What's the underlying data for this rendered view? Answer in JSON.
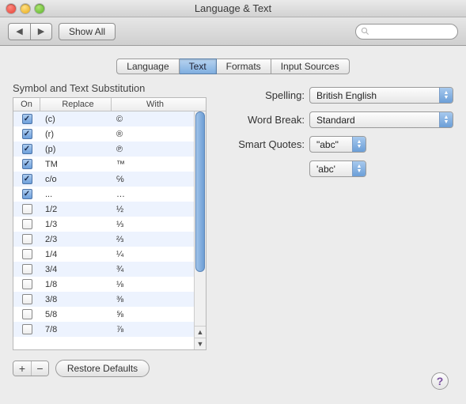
{
  "window": {
    "title": "Language & Text"
  },
  "toolbar": {
    "show_all": "Show All",
    "search_placeholder": ""
  },
  "tabs": [
    {
      "label": "Language",
      "active": false
    },
    {
      "label": "Text",
      "active": true
    },
    {
      "label": "Formats",
      "active": false
    },
    {
      "label": "Input Sources",
      "active": false
    }
  ],
  "section_title": "Symbol and Text Substitution",
  "columns": {
    "on": "On",
    "replace": "Replace",
    "with": "With"
  },
  "rows": [
    {
      "on": true,
      "replace": "(c)",
      "with": "©"
    },
    {
      "on": true,
      "replace": "(r)",
      "with": "®"
    },
    {
      "on": true,
      "replace": "(p)",
      "with": "℗"
    },
    {
      "on": true,
      "replace": "TM",
      "with": "™"
    },
    {
      "on": true,
      "replace": "c/o",
      "with": "℅"
    },
    {
      "on": true,
      "replace": "...",
      "with": "…"
    },
    {
      "on": false,
      "replace": "1/2",
      "with": "½"
    },
    {
      "on": false,
      "replace": "1/3",
      "with": "⅓"
    },
    {
      "on": false,
      "replace": "2/3",
      "with": "⅔"
    },
    {
      "on": false,
      "replace": "1/4",
      "with": "¼"
    },
    {
      "on": false,
      "replace": "3/4",
      "with": "¾"
    },
    {
      "on": false,
      "replace": "1/8",
      "with": "⅛"
    },
    {
      "on": false,
      "replace": "3/8",
      "with": "⅜"
    },
    {
      "on": false,
      "replace": "5/8",
      "with": "⅝"
    },
    {
      "on": false,
      "replace": "7/8",
      "with": "⅞"
    }
  ],
  "buttons": {
    "add": "+",
    "remove": "−",
    "restore": "Restore Defaults",
    "help": "?"
  },
  "form": {
    "spelling": {
      "label": "Spelling:",
      "value": "British English"
    },
    "wordbreak": {
      "label": "Word Break:",
      "value": "Standard"
    },
    "smartquotes": {
      "label": "Smart Quotes:",
      "double": "\"abc\"",
      "single": "'abc'"
    }
  }
}
